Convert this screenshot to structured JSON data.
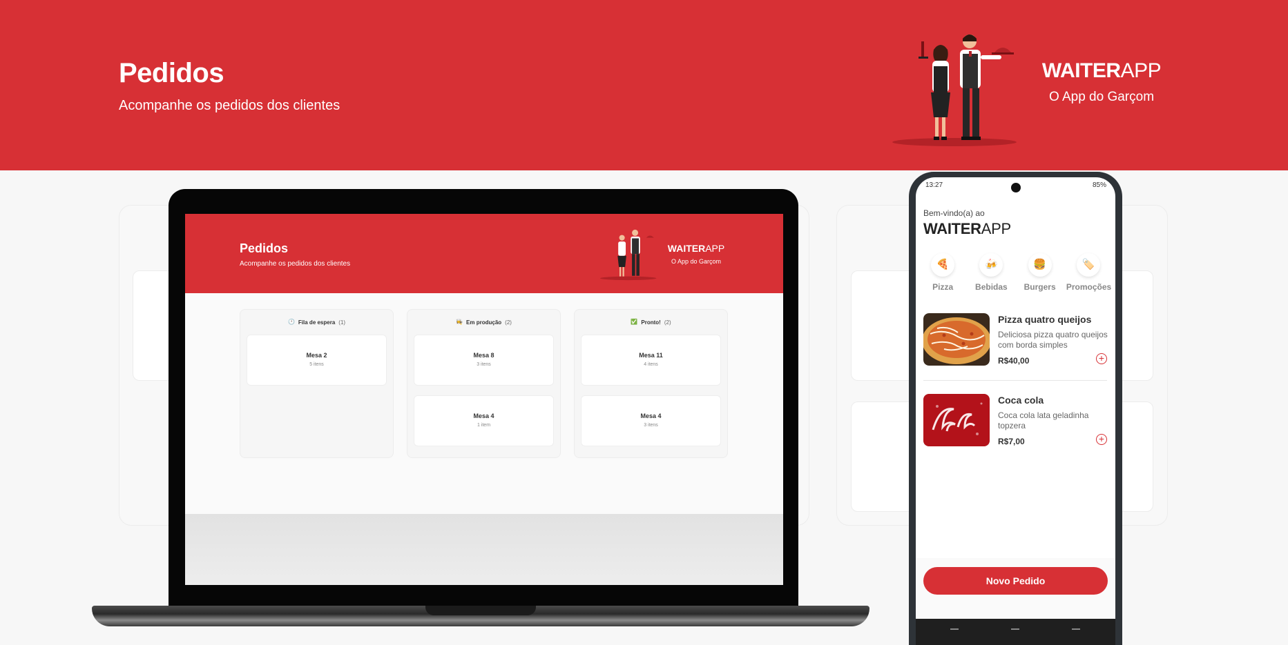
{
  "banner": {
    "title": "Pedidos",
    "subtitle": "Acompanhe os pedidos dos clientes",
    "brand_bold": "WAITER",
    "brand_light": "APP",
    "brand_tagline": "O App do Garçom"
  },
  "laptop": {
    "title": "Pedidos",
    "subtitle": "Acompanhe os pedidos dos clientes",
    "brand_bold": "WAITER",
    "brand_light": "APP",
    "brand_tagline": "O App do Garçom",
    "boards": [
      {
        "icon": "clock-icon",
        "glyph": "🕐",
        "label": "Fila de espera",
        "count": "(1)",
        "orders": [
          {
            "table": "Mesa 2",
            "items": "5 itens"
          }
        ]
      },
      {
        "icon": "chef-icon",
        "glyph": "👩‍🍳",
        "label": "Em produção",
        "count": "(2)",
        "orders": [
          {
            "table": "Mesa 8",
            "items": "3 itens"
          },
          {
            "table": "Mesa 4",
            "items": "1 item"
          }
        ]
      },
      {
        "icon": "check-icon",
        "glyph": "✅",
        "label": "Pronto!",
        "count": "(2)",
        "orders": [
          {
            "table": "Mesa 11",
            "items": "4 itens"
          },
          {
            "table": "Mesa 4",
            "items": "3 itens"
          }
        ]
      }
    ]
  },
  "phone": {
    "status": {
      "time": "13:27",
      "battery": "85%"
    },
    "welcome": "Bem-vindo(a) ao",
    "brand_bold": "WAITER",
    "brand_light": "APP",
    "categories": [
      {
        "icon": "pizza-icon",
        "glyph": "🍕",
        "label": "Pizza"
      },
      {
        "icon": "drink-icon",
        "glyph": "🍻",
        "label": "Bebidas"
      },
      {
        "icon": "burger-icon",
        "glyph": "🍔",
        "label": "Burgers"
      },
      {
        "icon": "tag-icon",
        "glyph": "🏷️",
        "label": "Promoções"
      }
    ],
    "products": [
      {
        "name": "Pizza quatro queijos",
        "description": "Deliciosa pizza quatro queijos com borda simples",
        "price": "R$40,00"
      },
      {
        "name": "Coca cola",
        "description": "Coca cola lata geladinha topzera",
        "price": "R$7,00"
      }
    ],
    "new_order_label": "Novo Pedido"
  },
  "colors": {
    "brand_red": "#d73035",
    "background": "#f7f7f7"
  }
}
